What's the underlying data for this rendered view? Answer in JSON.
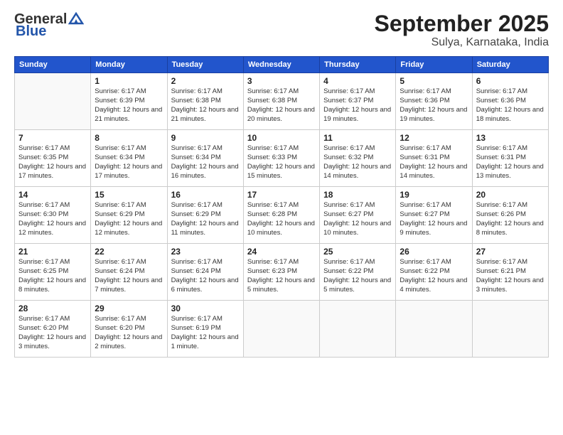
{
  "header": {
    "logo_line1": "General",
    "logo_line2": "Blue",
    "title": "September 2025",
    "subtitle": "Sulya, Karnataka, India"
  },
  "weekdays": [
    "Sunday",
    "Monday",
    "Tuesday",
    "Wednesday",
    "Thursday",
    "Friday",
    "Saturday"
  ],
  "weeks": [
    [
      {
        "num": "",
        "sunrise": "",
        "sunset": "",
        "daylight": ""
      },
      {
        "num": "1",
        "sunrise": "Sunrise: 6:17 AM",
        "sunset": "Sunset: 6:39 PM",
        "daylight": "Daylight: 12 hours and 21 minutes."
      },
      {
        "num": "2",
        "sunrise": "Sunrise: 6:17 AM",
        "sunset": "Sunset: 6:38 PM",
        "daylight": "Daylight: 12 hours and 21 minutes."
      },
      {
        "num": "3",
        "sunrise": "Sunrise: 6:17 AM",
        "sunset": "Sunset: 6:38 PM",
        "daylight": "Daylight: 12 hours and 20 minutes."
      },
      {
        "num": "4",
        "sunrise": "Sunrise: 6:17 AM",
        "sunset": "Sunset: 6:37 PM",
        "daylight": "Daylight: 12 hours and 19 minutes."
      },
      {
        "num": "5",
        "sunrise": "Sunrise: 6:17 AM",
        "sunset": "Sunset: 6:36 PM",
        "daylight": "Daylight: 12 hours and 19 minutes."
      },
      {
        "num": "6",
        "sunrise": "Sunrise: 6:17 AM",
        "sunset": "Sunset: 6:36 PM",
        "daylight": "Daylight: 12 hours and 18 minutes."
      }
    ],
    [
      {
        "num": "7",
        "sunrise": "Sunrise: 6:17 AM",
        "sunset": "Sunset: 6:35 PM",
        "daylight": "Daylight: 12 hours and 17 minutes."
      },
      {
        "num": "8",
        "sunrise": "Sunrise: 6:17 AM",
        "sunset": "Sunset: 6:34 PM",
        "daylight": "Daylight: 12 hours and 17 minutes."
      },
      {
        "num": "9",
        "sunrise": "Sunrise: 6:17 AM",
        "sunset": "Sunset: 6:34 PM",
        "daylight": "Daylight: 12 hours and 16 minutes."
      },
      {
        "num": "10",
        "sunrise": "Sunrise: 6:17 AM",
        "sunset": "Sunset: 6:33 PM",
        "daylight": "Daylight: 12 hours and 15 minutes."
      },
      {
        "num": "11",
        "sunrise": "Sunrise: 6:17 AM",
        "sunset": "Sunset: 6:32 PM",
        "daylight": "Daylight: 12 hours and 14 minutes."
      },
      {
        "num": "12",
        "sunrise": "Sunrise: 6:17 AM",
        "sunset": "Sunset: 6:31 PM",
        "daylight": "Daylight: 12 hours and 14 minutes."
      },
      {
        "num": "13",
        "sunrise": "Sunrise: 6:17 AM",
        "sunset": "Sunset: 6:31 PM",
        "daylight": "Daylight: 12 hours and 13 minutes."
      }
    ],
    [
      {
        "num": "14",
        "sunrise": "Sunrise: 6:17 AM",
        "sunset": "Sunset: 6:30 PM",
        "daylight": "Daylight: 12 hours and 12 minutes."
      },
      {
        "num": "15",
        "sunrise": "Sunrise: 6:17 AM",
        "sunset": "Sunset: 6:29 PM",
        "daylight": "Daylight: 12 hours and 12 minutes."
      },
      {
        "num": "16",
        "sunrise": "Sunrise: 6:17 AM",
        "sunset": "Sunset: 6:29 PM",
        "daylight": "Daylight: 12 hours and 11 minutes."
      },
      {
        "num": "17",
        "sunrise": "Sunrise: 6:17 AM",
        "sunset": "Sunset: 6:28 PM",
        "daylight": "Daylight: 12 hours and 10 minutes."
      },
      {
        "num": "18",
        "sunrise": "Sunrise: 6:17 AM",
        "sunset": "Sunset: 6:27 PM",
        "daylight": "Daylight: 12 hours and 10 minutes."
      },
      {
        "num": "19",
        "sunrise": "Sunrise: 6:17 AM",
        "sunset": "Sunset: 6:27 PM",
        "daylight": "Daylight: 12 hours and 9 minutes."
      },
      {
        "num": "20",
        "sunrise": "Sunrise: 6:17 AM",
        "sunset": "Sunset: 6:26 PM",
        "daylight": "Daylight: 12 hours and 8 minutes."
      }
    ],
    [
      {
        "num": "21",
        "sunrise": "Sunrise: 6:17 AM",
        "sunset": "Sunset: 6:25 PM",
        "daylight": "Daylight: 12 hours and 8 minutes."
      },
      {
        "num": "22",
        "sunrise": "Sunrise: 6:17 AM",
        "sunset": "Sunset: 6:24 PM",
        "daylight": "Daylight: 12 hours and 7 minutes."
      },
      {
        "num": "23",
        "sunrise": "Sunrise: 6:17 AM",
        "sunset": "Sunset: 6:24 PM",
        "daylight": "Daylight: 12 hours and 6 minutes."
      },
      {
        "num": "24",
        "sunrise": "Sunrise: 6:17 AM",
        "sunset": "Sunset: 6:23 PM",
        "daylight": "Daylight: 12 hours and 5 minutes."
      },
      {
        "num": "25",
        "sunrise": "Sunrise: 6:17 AM",
        "sunset": "Sunset: 6:22 PM",
        "daylight": "Daylight: 12 hours and 5 minutes."
      },
      {
        "num": "26",
        "sunrise": "Sunrise: 6:17 AM",
        "sunset": "Sunset: 6:22 PM",
        "daylight": "Daylight: 12 hours and 4 minutes."
      },
      {
        "num": "27",
        "sunrise": "Sunrise: 6:17 AM",
        "sunset": "Sunset: 6:21 PM",
        "daylight": "Daylight: 12 hours and 3 minutes."
      }
    ],
    [
      {
        "num": "28",
        "sunrise": "Sunrise: 6:17 AM",
        "sunset": "Sunset: 6:20 PM",
        "daylight": "Daylight: 12 hours and 3 minutes."
      },
      {
        "num": "29",
        "sunrise": "Sunrise: 6:17 AM",
        "sunset": "Sunset: 6:20 PM",
        "daylight": "Daylight: 12 hours and 2 minutes."
      },
      {
        "num": "30",
        "sunrise": "Sunrise: 6:17 AM",
        "sunset": "Sunset: 6:19 PM",
        "daylight": "Daylight: 12 hours and 1 minute."
      },
      {
        "num": "",
        "sunrise": "",
        "sunset": "",
        "daylight": ""
      },
      {
        "num": "",
        "sunrise": "",
        "sunset": "",
        "daylight": ""
      },
      {
        "num": "",
        "sunrise": "",
        "sunset": "",
        "daylight": ""
      },
      {
        "num": "",
        "sunrise": "",
        "sunset": "",
        "daylight": ""
      }
    ]
  ]
}
